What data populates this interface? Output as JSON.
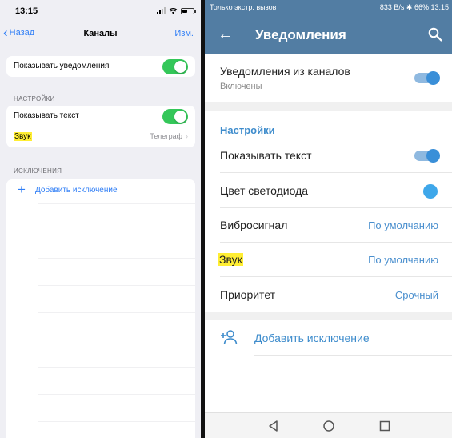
{
  "ios": {
    "status": {
      "time": "13:15"
    },
    "nav": {
      "back_label": "Назад",
      "title": "Каналы",
      "edit_label": "Изм."
    },
    "top_group": {
      "show_notifications_label": "Показывать уведомления"
    },
    "settings_section": {
      "header": "НАСТРОЙКИ",
      "show_text_label": "Показывать текст",
      "sound_label": "Звук",
      "sound_value": "Телеграф"
    },
    "exceptions_section": {
      "header": "ИСКЛЮЧЕНИЯ",
      "add_exception_label": "Добавить исключение"
    }
  },
  "android": {
    "status": {
      "left_text": "Только экстр. вызов",
      "right_text": "833 B/s ✱ 66% 13:15"
    },
    "appbar": {
      "title": "Уведомления"
    },
    "channel_notifications": {
      "label": "Уведомления из каналов",
      "sublabel": "Включены"
    },
    "settings": {
      "header": "Настройки",
      "show_text_label": "Показывать текст",
      "led_color_label": "Цвет светодиода",
      "vibration_label": "Вибросигнал",
      "vibration_value": "По умолчанию",
      "sound_label": "Звук",
      "sound_value": "По умолчанию",
      "priority_label": "Приоритет",
      "priority_value": "Срочный"
    },
    "add_exception_label": "Добавить исключение"
  },
  "colors": {
    "ios_accent": "#2f7ef6",
    "ios_switch_on": "#34c759",
    "android_header": "#527da3",
    "android_accent": "#3e8ccc",
    "highlight": "#ffee33"
  }
}
